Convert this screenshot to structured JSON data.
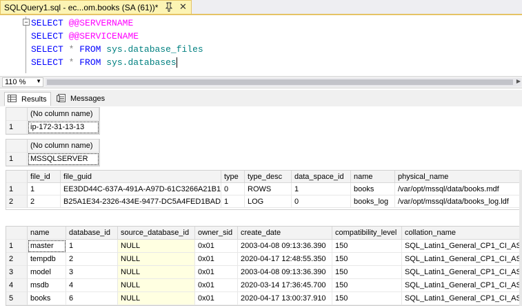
{
  "document_tab": {
    "title": "SQLQuery1.sql - ec...om.books (SA (61))*",
    "pin_icon": "pin-icon",
    "close_label": "✕"
  },
  "editor": {
    "lines": [
      {
        "kw": "SELECT",
        "rest_a": "",
        "sv": "@@SERVERNAME",
        "rest_b": ""
      },
      {
        "kw": "SELECT",
        "rest_a": "",
        "sv": "@@SERVICENAME",
        "rest_b": ""
      },
      {
        "kw": "SELECT",
        "star": "*",
        "from": "FROM",
        "obj": "sys.database_files"
      },
      {
        "kw": "SELECT",
        "star": "*",
        "from": "FROM",
        "obj": "sys.databases"
      }
    ]
  },
  "zoom": {
    "value": "110 %"
  },
  "result_tabs": [
    {
      "label": "Results",
      "icon": "grid-icon"
    },
    {
      "label": "Messages",
      "icon": "messages-icon"
    }
  ],
  "grids": {
    "servername": {
      "headers": [
        "(No column name)"
      ],
      "rows": [
        [
          "1",
          "ip-172-31-13-13"
        ]
      ]
    },
    "servicename": {
      "headers": [
        "(No column name)"
      ],
      "rows": [
        [
          "1",
          "MSSQLSERVER"
        ]
      ]
    },
    "database_files": {
      "headers": [
        "file_id",
        "file_guid",
        "type",
        "type_desc",
        "data_space_id",
        "name",
        "physical_name"
      ],
      "rows": [
        [
          "1",
          "1",
          "EE3DD44C-637A-491A-A97D-61C3266A21B1",
          "0",
          "ROWS",
          "1",
          "books",
          "/var/opt/mssql/data/books.mdf"
        ],
        [
          "2",
          "2",
          "B25A1E34-2326-434E-9477-DC5A4FED1BAD",
          "1",
          "LOG",
          "0",
          "books_log",
          "/var/opt/mssql/data/books_log.ldf"
        ]
      ]
    },
    "databases": {
      "headers": [
        "name",
        "database_id",
        "source_database_id",
        "owner_sid",
        "create_date",
        "compatibility_level",
        "collation_name"
      ],
      "rows": [
        [
          "1",
          "master",
          "1",
          "NULL",
          "0x01",
          "2003-04-08 09:13:36.390",
          "150",
          "SQL_Latin1_General_CP1_CI_AS"
        ],
        [
          "2",
          "tempdb",
          "2",
          "NULL",
          "0x01",
          "2020-04-17 12:48:55.350",
          "150",
          "SQL_Latin1_General_CP1_CI_AS"
        ],
        [
          "3",
          "model",
          "3",
          "NULL",
          "0x01",
          "2003-04-08 09:13:36.390",
          "150",
          "SQL_Latin1_General_CP1_CI_AS"
        ],
        [
          "4",
          "msdb",
          "4",
          "NULL",
          "0x01",
          "2020-03-14 17:36:45.700",
          "150",
          "SQL_Latin1_General_CP1_CI_AS"
        ],
        [
          "5",
          "books",
          "6",
          "NULL",
          "0x01",
          "2020-04-17 13:00:37.910",
          "150",
          "SQL_Latin1_General_CP1_CI_AS"
        ]
      ]
    }
  },
  "colors": {
    "keyword": "#0000ff",
    "system_var": "#ff00ff",
    "identifier": "#008080",
    "null_cell": "#ffffe1",
    "doc_tab": "#fcf4b4"
  }
}
